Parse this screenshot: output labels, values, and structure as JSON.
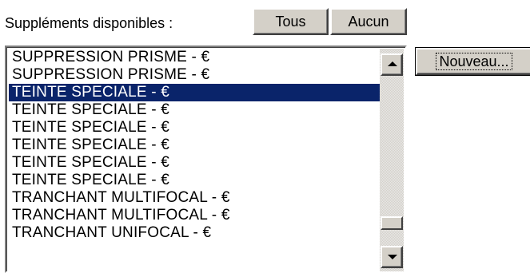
{
  "header": {
    "label": "Suppléments disponibles :",
    "all_button": "Tous",
    "none_button": "Aucun"
  },
  "actions": {
    "new_button": "Nouveau..."
  },
  "list": {
    "items": [
      "SUPPRESSION PRISME - €",
      "SUPPRESSION PRISME - €",
      "TEINTE SPECIALE - €",
      "TEINTE SPECIALE - €",
      "TEINTE SPECIALE - €",
      "TEINTE SPECIALE - €",
      "TEINTE SPECIALE - €",
      "TEINTE SPECIALE - €",
      "TRANCHANT MULTIFOCAL - €",
      "TRANCHANT MULTIFOCAL - €",
      "TRANCHANT UNIFOCAL - €"
    ],
    "selected_index": 2
  },
  "colors": {
    "selection_bg": "#0a246a",
    "selection_fg": "#ffffff",
    "button_face": "#d4d0c8"
  },
  "icons": {
    "scroll_up": "scroll-up-arrow-icon",
    "scroll_down": "scroll-down-arrow-icon"
  }
}
